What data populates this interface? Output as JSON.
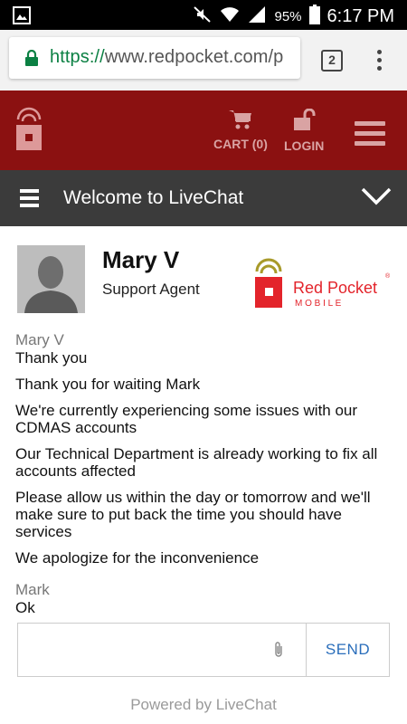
{
  "status_bar": {
    "battery": "95%",
    "time": "6:17 PM",
    "icons": [
      "gallery-icon",
      "mute-icon",
      "wifi-icon",
      "signal-icon",
      "battery-icon"
    ]
  },
  "browser": {
    "url_scheme": "https://",
    "url_rest": "www.redpocket.com/p",
    "tab_count": "2"
  },
  "site_header": {
    "cart_label": "CART (0)",
    "login_label": "LOGIN"
  },
  "chat_header": {
    "title": "Welcome to LiveChat"
  },
  "agent": {
    "name": "Mary V",
    "role": "Support Agent"
  },
  "brand": {
    "line1": "Red Pocket",
    "line2": "M O B I L E",
    "color": "#e3242b",
    "accent": "#a89a2a"
  },
  "messages": [
    {
      "author": "Mary V",
      "lines": [
        "Thank you",
        "Thank you for waiting Mark",
        "We're currently experiencing some issues with our CDMAS accounts",
        "Our Technical Department is already working to fix all accounts affected",
        "Please allow us within the day or tomorrow and we'll make sure to put back the time you should have services",
        "We apologize for the inconvenience"
      ]
    },
    {
      "author": "Mark",
      "lines": [
        "Ok"
      ]
    }
  ],
  "composer": {
    "placeholder": "",
    "send_label": "SEND"
  },
  "footer": {
    "powered_by": "Powered by LiveChat"
  },
  "colors": {
    "header_red": "#8b1111",
    "chat_header": "#3b3b3b",
    "send_blue": "#2a6ebb"
  }
}
